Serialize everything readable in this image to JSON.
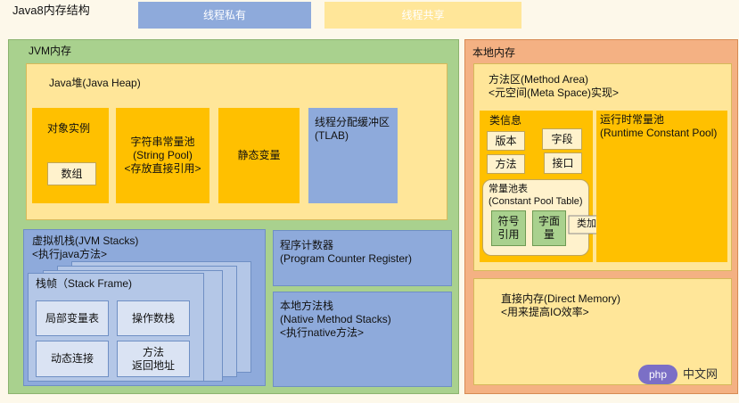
{
  "title": "Java8内存结构",
  "legend": {
    "private": "线程私有",
    "shared": "线程共享"
  },
  "jvm": {
    "title": "JVM内存",
    "heap": {
      "title": "Java堆(Java Heap)",
      "object_instance": "对象实例",
      "array": "数组",
      "string_pool": "字符串常量池\n(String Pool)\n<存放直接引用>",
      "static_vars": "静态变量",
      "tlab": "线程分配缓冲区\n(TLAB)"
    },
    "stacks": {
      "title": "虚拟机栈(JVM Stacks)",
      "subtitle": "<执行java方法>",
      "frame_title": "栈帧（Stack Frame)",
      "local_vars": "局部变量表",
      "operand_stack": "操作数栈",
      "dynamic_link": "动态连接",
      "return_addr": "方法\n返回地址"
    },
    "pc_register": "程序计数器\n(Program Counter Register)",
    "native_stacks": "本地方法栈\n(Native Method Stacks)\n<执行native方法>"
  },
  "native": {
    "title": "本地内存",
    "method_area": {
      "title": "方法区(Method Area)",
      "subtitle": "<元空间(Meta Space)实现>"
    },
    "class_info": {
      "title": "类信息",
      "version": "版本",
      "field": "字段",
      "method": "方法",
      "interface": "接口",
      "const_pool": "常量池表\n(Constant Pool Table)",
      "symbol_ref": "符号\n引用",
      "literal": "字面\n量"
    },
    "after_load": "类加载后",
    "runtime_pool": "运行时常量池\n(Runtime Constant Pool)",
    "direct_memory": "直接内存(Direct Memory)\n<用来提高IO效率>"
  },
  "watermark": {
    "logo": "php",
    "text": "中文网"
  },
  "colors": {
    "private": "#8eaadb",
    "shared": "#ffe699",
    "jvm_bg": "#a9d18e",
    "native_bg": "#f4b183",
    "gold": "#ffc000"
  }
}
